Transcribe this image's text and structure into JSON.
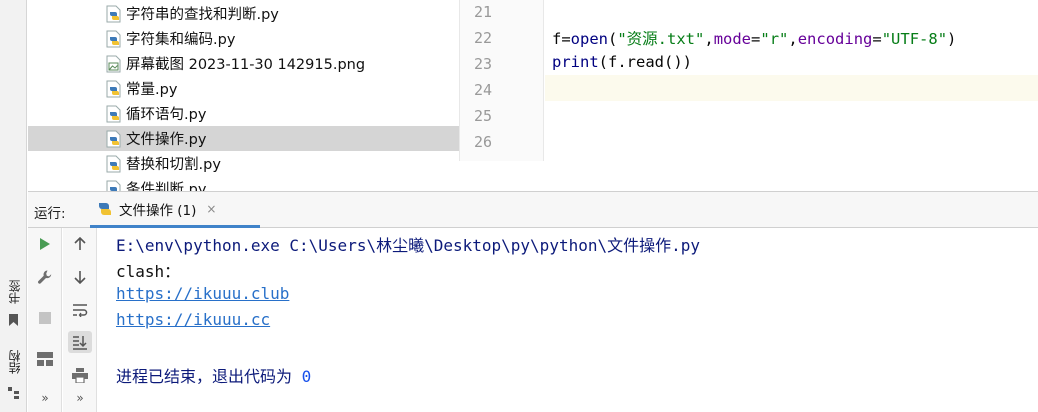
{
  "left_strip": {
    "bookmarks_label": "书签",
    "structure_label": "结构"
  },
  "tree": {
    "items": [
      {
        "name": "字符串的查找和判断.py",
        "icon": "python-file-icon",
        "selected": false
      },
      {
        "name": "字符集和编码.py",
        "icon": "python-file-icon",
        "selected": false
      },
      {
        "name": "屏幕截图 2023-11-30 142915.png",
        "icon": "image-file-icon",
        "selected": false
      },
      {
        "name": "常量.py",
        "icon": "python-file-icon",
        "selected": false
      },
      {
        "name": "循环语句.py",
        "icon": "python-file-icon",
        "selected": false
      },
      {
        "name": "文件操作.py",
        "icon": "python-file-icon",
        "selected": true
      },
      {
        "name": "替换和切割.py",
        "icon": "python-file-icon",
        "selected": false
      },
      {
        "name": "条件判断.py",
        "icon": "python-file-icon",
        "selected": false
      }
    ]
  },
  "editor": {
    "line_numbers": [
      "21",
      "22",
      "23",
      "24",
      "25",
      "26"
    ],
    "code": {
      "line22": {
        "var": "f=",
        "func": "open",
        "p1": "(",
        "s1": "\"资源.txt\"",
        "c1": ",",
        "k1": "mode",
        "e1": "=",
        "s2": "\"r\"",
        "c2": ",",
        "k2": "encoding",
        "e2": "=",
        "s3": "\"UTF-8\"",
        "p2": ")"
      },
      "line23": {
        "func": "print",
        "rest": "(f.read())"
      }
    }
  },
  "run_panel": {
    "label": "运行:",
    "tab_title": "文件操作 (1)",
    "tab_close": "×"
  },
  "console": {
    "command": "E:\\env\\python.exe C:\\Users\\林尘曦\\Desktop\\py\\python\\文件操作.py",
    "output_label": "clash：",
    "link1": "https://ikuuu.club",
    "link2": "https://ikuuu.cc",
    "exit_message": "进程已结束，退出代码为 ",
    "exit_code": "0"
  },
  "colors": {
    "selection": "#d5d5d5",
    "current_line": "#fcfaed",
    "link": "#2870c9",
    "string": "#067d17",
    "param": "#660099",
    "run_green": "#499c54"
  }
}
